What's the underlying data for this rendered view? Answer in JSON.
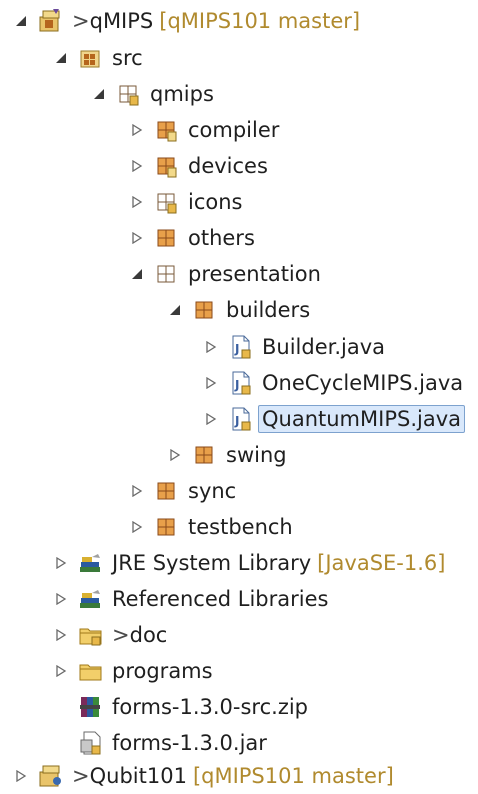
{
  "tree": {
    "project_qmips": {
      "prefix": "> ",
      "label": "qMIPS",
      "decoration": "[qMIPS101 master]"
    },
    "src": {
      "label": "src"
    },
    "qmips": {
      "label": "qmips"
    },
    "compiler": {
      "label": "compiler"
    },
    "devices": {
      "label": "devices"
    },
    "icons": {
      "label": "icons"
    },
    "others": {
      "label": "others"
    },
    "presentation": {
      "label": "presentation"
    },
    "builders": {
      "label": "builders"
    },
    "builder_java": {
      "label": "Builder.java"
    },
    "onecycle_java": {
      "label": "OneCycleMIPS.java"
    },
    "quantum_java": {
      "label": "QuantumMIPS.java"
    },
    "swing": {
      "label": "swing"
    },
    "sync": {
      "label": "sync"
    },
    "testbench": {
      "label": "testbench"
    },
    "jre": {
      "label": "JRE System Library",
      "decoration": "[JavaSE-1.6]"
    },
    "reflibs": {
      "label": "Referenced Libraries"
    },
    "doc": {
      "prefix": "> ",
      "label": "doc"
    },
    "programs": {
      "label": "programs"
    },
    "forms_src_zip": {
      "label": "forms-1.3.0-src.zip"
    },
    "forms_jar": {
      "label": "forms-1.3.0.jar"
    },
    "project_qubit": {
      "prefix": "> ",
      "label": "Qubit101",
      "decoration": "[qMIPS101 master]"
    }
  },
  "colors": {
    "selection_bg": "#d9e8fb",
    "selection_border": "#7da2ce",
    "decoration_text": "#b08a2e",
    "package_brown": "#b5651d"
  },
  "icons": {
    "expanded": "triangle-filled-down-right",
    "collapsed": "triangle-outline-right",
    "project": "git-project-icon",
    "package": "package-icon",
    "java_file": "java-file-icon",
    "library": "library-icon",
    "folder": "folder-icon",
    "zip": "zip-archive-icon",
    "jar": "jar-file-icon"
  }
}
